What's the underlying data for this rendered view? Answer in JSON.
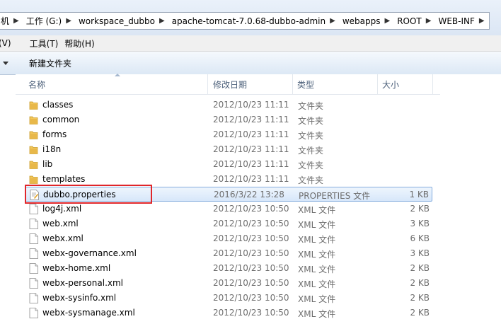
{
  "address": {
    "crumbs": [
      "机",
      "工作 (G:)",
      "workspace_dubbo",
      "apache-tomcat-7.0.68-dubbo-admin",
      "webapps",
      "ROOT",
      "WEB-INF"
    ]
  },
  "menubar": {
    "items": [
      "(V)",
      "工具(T)",
      "帮助(H)"
    ]
  },
  "toolbar": {
    "new_folder": "新建文件夹"
  },
  "columns": {
    "name": "名称",
    "date": "修改日期",
    "type": "类型",
    "size": "大小"
  },
  "files": [
    {
      "name": "classes",
      "date": "2012/10/23 11:11",
      "type": "文件夹",
      "size": "",
      "kind": "folder"
    },
    {
      "name": "common",
      "date": "2012/10/23 11:11",
      "type": "文件夹",
      "size": "",
      "kind": "folder"
    },
    {
      "name": "forms",
      "date": "2012/10/23 11:11",
      "type": "文件夹",
      "size": "",
      "kind": "folder"
    },
    {
      "name": "i18n",
      "date": "2012/10/23 11:11",
      "type": "文件夹",
      "size": "",
      "kind": "folder"
    },
    {
      "name": "lib",
      "date": "2012/10/23 11:11",
      "type": "文件夹",
      "size": "",
      "kind": "folder"
    },
    {
      "name": "templates",
      "date": "2012/10/23 11:11",
      "type": "文件夹",
      "size": "",
      "kind": "folder"
    },
    {
      "name": "dubbo.properties",
      "date": "2016/3/22 13:28",
      "type": "PROPERTIES 文件",
      "size": "1 KB",
      "kind": "properties",
      "selected": true
    },
    {
      "name": "log4j.xml",
      "date": "2012/10/23 10:50",
      "type": "XML 文件",
      "size": "2 KB",
      "kind": "file"
    },
    {
      "name": "web.xml",
      "date": "2012/10/23 10:50",
      "type": "XML 文件",
      "size": "3 KB",
      "kind": "file"
    },
    {
      "name": "webx.xml",
      "date": "2012/10/23 10:50",
      "type": "XML 文件",
      "size": "6 KB",
      "kind": "file"
    },
    {
      "name": "webx-governance.xml",
      "date": "2012/10/23 10:50",
      "type": "XML 文件",
      "size": "3 KB",
      "kind": "file"
    },
    {
      "name": "webx-home.xml",
      "date": "2012/10/23 10:50",
      "type": "XML 文件",
      "size": "2 KB",
      "kind": "file"
    },
    {
      "name": "webx-personal.xml",
      "date": "2012/10/23 10:50",
      "type": "XML 文件",
      "size": "2 KB",
      "kind": "file"
    },
    {
      "name": "webx-sysinfo.xml",
      "date": "2012/10/23 10:50",
      "type": "XML 文件",
      "size": "2 KB",
      "kind": "file"
    },
    {
      "name": "webx-sysmanage.xml",
      "date": "2012/10/23 10:50",
      "type": "XML 文件",
      "size": "2 KB",
      "kind": "file"
    }
  ],
  "colors": {
    "highlight": "#e0262a",
    "selection_border": "#84acdd",
    "folder": "#e8b84a"
  }
}
